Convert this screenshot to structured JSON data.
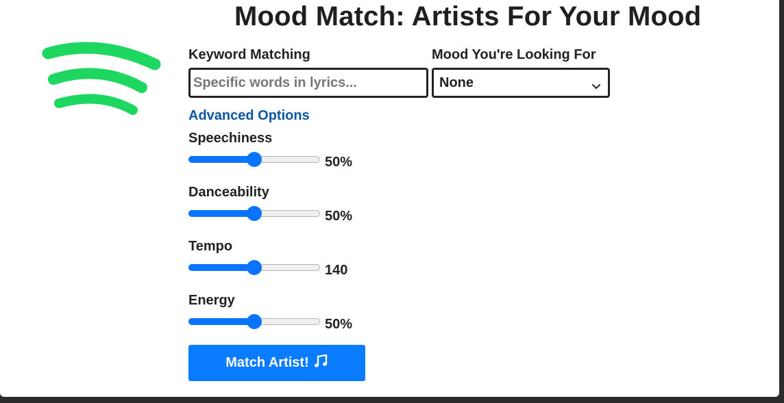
{
  "header": {
    "title": "Mood Match: Artists For Your Mood",
    "logo_icon": "spotify-logo-icon",
    "logo_color": "#1ed760"
  },
  "keyword": {
    "label": "Keyword Matching",
    "placeholder": "Specific words in lyrics...",
    "value": ""
  },
  "mood": {
    "label": "Mood You're Looking For",
    "selected": "None",
    "icon": "chevron-down-icon"
  },
  "advanced": {
    "label": "Advanced Options",
    "color": "#0b57a4"
  },
  "sliders": [
    {
      "label": "Speechiness",
      "value_text": "50%",
      "fraction": 0.5
    },
    {
      "label": "Danceability",
      "value_text": "50%",
      "fraction": 0.5
    },
    {
      "label": "Tempo",
      "value_text": "140",
      "fraction": 0.5
    },
    {
      "label": "Energy",
      "value_text": "50%",
      "fraction": 0.5
    }
  ],
  "match_button": {
    "label": "Match Artist!",
    "icon": "music-note-icon",
    "color": "#0a7cff"
  },
  "accent_color": "#0a74ff"
}
